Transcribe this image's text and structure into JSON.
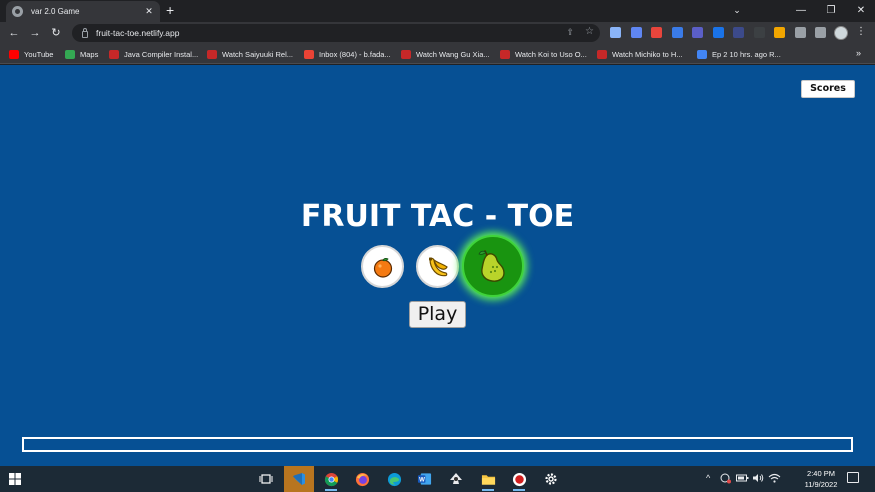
{
  "browser": {
    "tab_title": "var 2.0 Game",
    "tab_close": "✕",
    "new_tab": "+",
    "window_controls": {
      "chevron": "⌄",
      "minimize": "—",
      "restore": "❐",
      "close": "✕"
    },
    "url": "fruit-tac-toe.netlify.app",
    "nav": {
      "back": "←",
      "forward": "→",
      "reload": "↻"
    },
    "share_icon": "⇪",
    "star_icon": "☆",
    "menu_icon": "⋮",
    "extension_colors": [
      "#8ab4f8",
      "#5f86f2",
      "#e8453c",
      "#3a7be8",
      "#5b5fc7",
      "#1a73e8",
      "#3c4a8a",
      "#3c4043",
      "#f2a600",
      "#9aa0a6",
      "#9aa0a6"
    ],
    "bookmarks": [
      {
        "label": "YouTube",
        "icon_color": "#ff0000"
      },
      {
        "label": "Maps",
        "icon_color": "#34a853"
      },
      {
        "label": "Java Compiler Instal...",
        "icon_color": "#c62828"
      },
      {
        "label": "Watch Saiyuuki Rel...",
        "icon_color": "#c62828"
      },
      {
        "label": "Inbox (804) - b.fada...",
        "icon_color": "#ea4335"
      },
      {
        "label": "Watch Wang Gu Xia...",
        "icon_color": "#c62828"
      },
      {
        "label": "Watch Koi to Uso O...",
        "icon_color": "#c62828"
      },
      {
        "label": "Watch Michiko to H...",
        "icon_color": "#c62828"
      },
      {
        "label": "Ep 2 10 hrs. ago R...",
        "icon_color": "#4285f4"
      }
    ],
    "bookmarks_more": "»"
  },
  "page": {
    "background": "#065094",
    "scores_label": "Scores",
    "title": "FRUIT TAC - TOE",
    "fruits": [
      {
        "name": "orange",
        "selected": false
      },
      {
        "name": "banana",
        "selected": false
      },
      {
        "name": "pear",
        "selected": true
      }
    ],
    "selected_color": "#199410",
    "play_label": "Play"
  },
  "taskbar": {
    "clock_time": "2:40 PM",
    "clock_date": "11/9/2022",
    "tray_icons": [
      "chevron-up-icon",
      "network-icon",
      "battery-icon",
      "volume-icon",
      "wifi-icon"
    ],
    "apps": [
      "windows-start",
      "task-view",
      "vscode",
      "chrome",
      "firefox",
      "edge",
      "word",
      "inkscape",
      "file-explorer",
      "obs",
      "settings"
    ]
  }
}
